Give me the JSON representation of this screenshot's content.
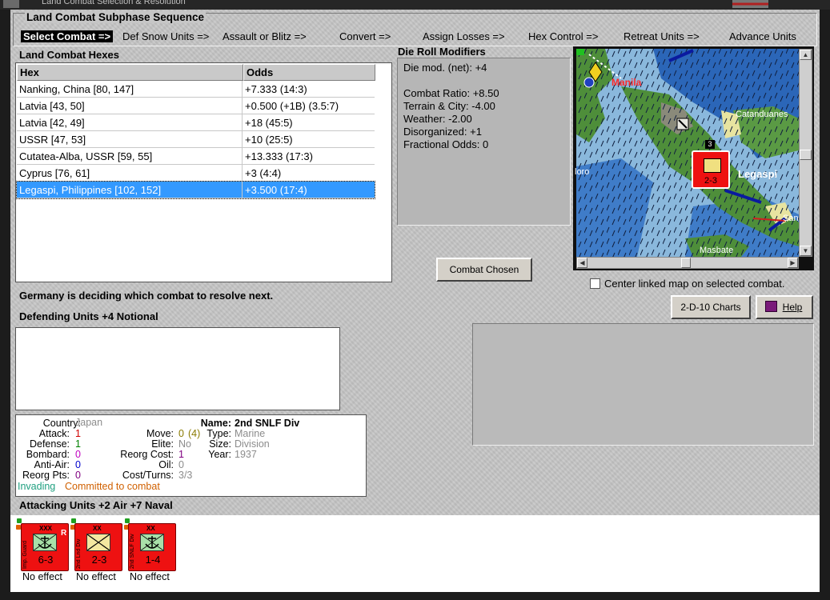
{
  "window": {
    "title": "Land Combat Selection & Resolution"
  },
  "sequence": {
    "title": "Land Combat Subphase Sequence",
    "steps": [
      {
        "label": "Select Combat =>",
        "active": true
      },
      {
        "label": "Def Snow Units =>"
      },
      {
        "label": "Assault or Blitz =>"
      },
      {
        "label": "Convert =>"
      },
      {
        "label": "Assign Losses =>"
      },
      {
        "label": "Hex Control =>"
      },
      {
        "label": "Retreat Units =>"
      },
      {
        "label": "Advance Units"
      }
    ]
  },
  "hexes": {
    "title": "Land Combat Hexes",
    "columns": [
      "Hex",
      "Odds"
    ],
    "rows": [
      {
        "hex": "Nanking, China [80, 147]",
        "odds": "+7.333 (14:3)"
      },
      {
        "hex": "Latvia [43, 50]",
        "odds": "+0.500 (+1B) (3.5:7)"
      },
      {
        "hex": "Latvia [42, 49]",
        "odds": "+18 (45:5)"
      },
      {
        "hex": "USSR [47, 53]",
        "odds": "+10 (25:5)"
      },
      {
        "hex": "Cutatea-Alba, USSR [59, 55]",
        "odds": "+13.333 (17:3)"
      },
      {
        "hex": "Cyprus [76, 61]",
        "odds": "+3 (4:4)"
      },
      {
        "hex": "Legaspi, Philippines [102, 152]",
        "odds": "+3.500 (17:4)",
        "selected": true
      }
    ]
  },
  "die_roll": {
    "title": "Die Roll Modifiers",
    "net": "Die mod. (net): +4",
    "lines": [
      "Combat Ratio: +8.50",
      "Terrain & City: -4.00",
      "Weather: -2.00",
      "Disorganized: +1",
      "Fractional Odds: 0"
    ]
  },
  "map": {
    "labels": {
      "manila": "Manila",
      "catanduanes": "Catanduanes",
      "legaspi": "Legaspi",
      "masbate": "Masbate",
      "mindoro": "loro",
      "san": "San"
    },
    "unit": {
      "strength": "2-3",
      "stack": "3"
    },
    "colors": {
      "sea_dark": "#2b66b8",
      "sea_light": "#8ab8dc",
      "land": "#4e8e3a",
      "unit": "#ee1111"
    }
  },
  "buttons": {
    "combat_chosen": "Combat Chosen",
    "charts": "2-D-10 Charts",
    "help": "Help"
  },
  "center_map_label": "Center linked map on selected combat.",
  "status_message": "Germany is deciding which combat to resolve next.",
  "defending": {
    "title": "Defending Units +4 Notional"
  },
  "unit_info": {
    "country_label": "Country:",
    "country": "Japan",
    "attack_label": "Attack:",
    "attack": "1",
    "defense_label": "Defense:",
    "defense": "1",
    "bombard_label": "Bombard:",
    "bombard": "0",
    "antiair_label": "Anti-Air:",
    "antiair": "0",
    "reorg_pts_label": "Reorg Pts:",
    "reorg_pts": "0",
    "move_label": "Move:",
    "move": "0",
    "move_extra": "(4)",
    "elite_label": "Elite:",
    "elite": "No",
    "reorg_cost_label": "Reorg Cost:",
    "reorg_cost": "1",
    "oil_label": "Oil:",
    "oil": "0",
    "cost_turns_label": "Cost/Turns:",
    "cost_turns": "3/3",
    "name_label": "Name:",
    "name": "2nd SNLF Div",
    "type_label": "Type:",
    "type": "Marine",
    "size_label": "Size:",
    "size": "Division",
    "year_label": "Year:",
    "year": "1937",
    "status_invading": "Invading",
    "status_committed": "Committed to combat"
  },
  "attacking": {
    "title": "Attacking Units +2 Air +7 Naval",
    "units": [
      {
        "name": "Imp. Guard",
        "size": "XXX",
        "flag": "R",
        "strength": "6-3",
        "effect": "No effect",
        "icon": "marine-anchor-icon",
        "fill": "#a8e0a8"
      },
      {
        "name": "2nd Lnd Div",
        "size": "XX",
        "flag": "",
        "strength": "2-3",
        "effect": "No effect",
        "icon": "infantry-x-icon",
        "fill": "#f4e8a0"
      },
      {
        "name": "2nd SNLF Div",
        "size": "XX",
        "flag": "",
        "strength": "1-4",
        "effect": "No effect",
        "icon": "marine-anchor-icon",
        "fill": "#a8e0a8"
      }
    ]
  }
}
